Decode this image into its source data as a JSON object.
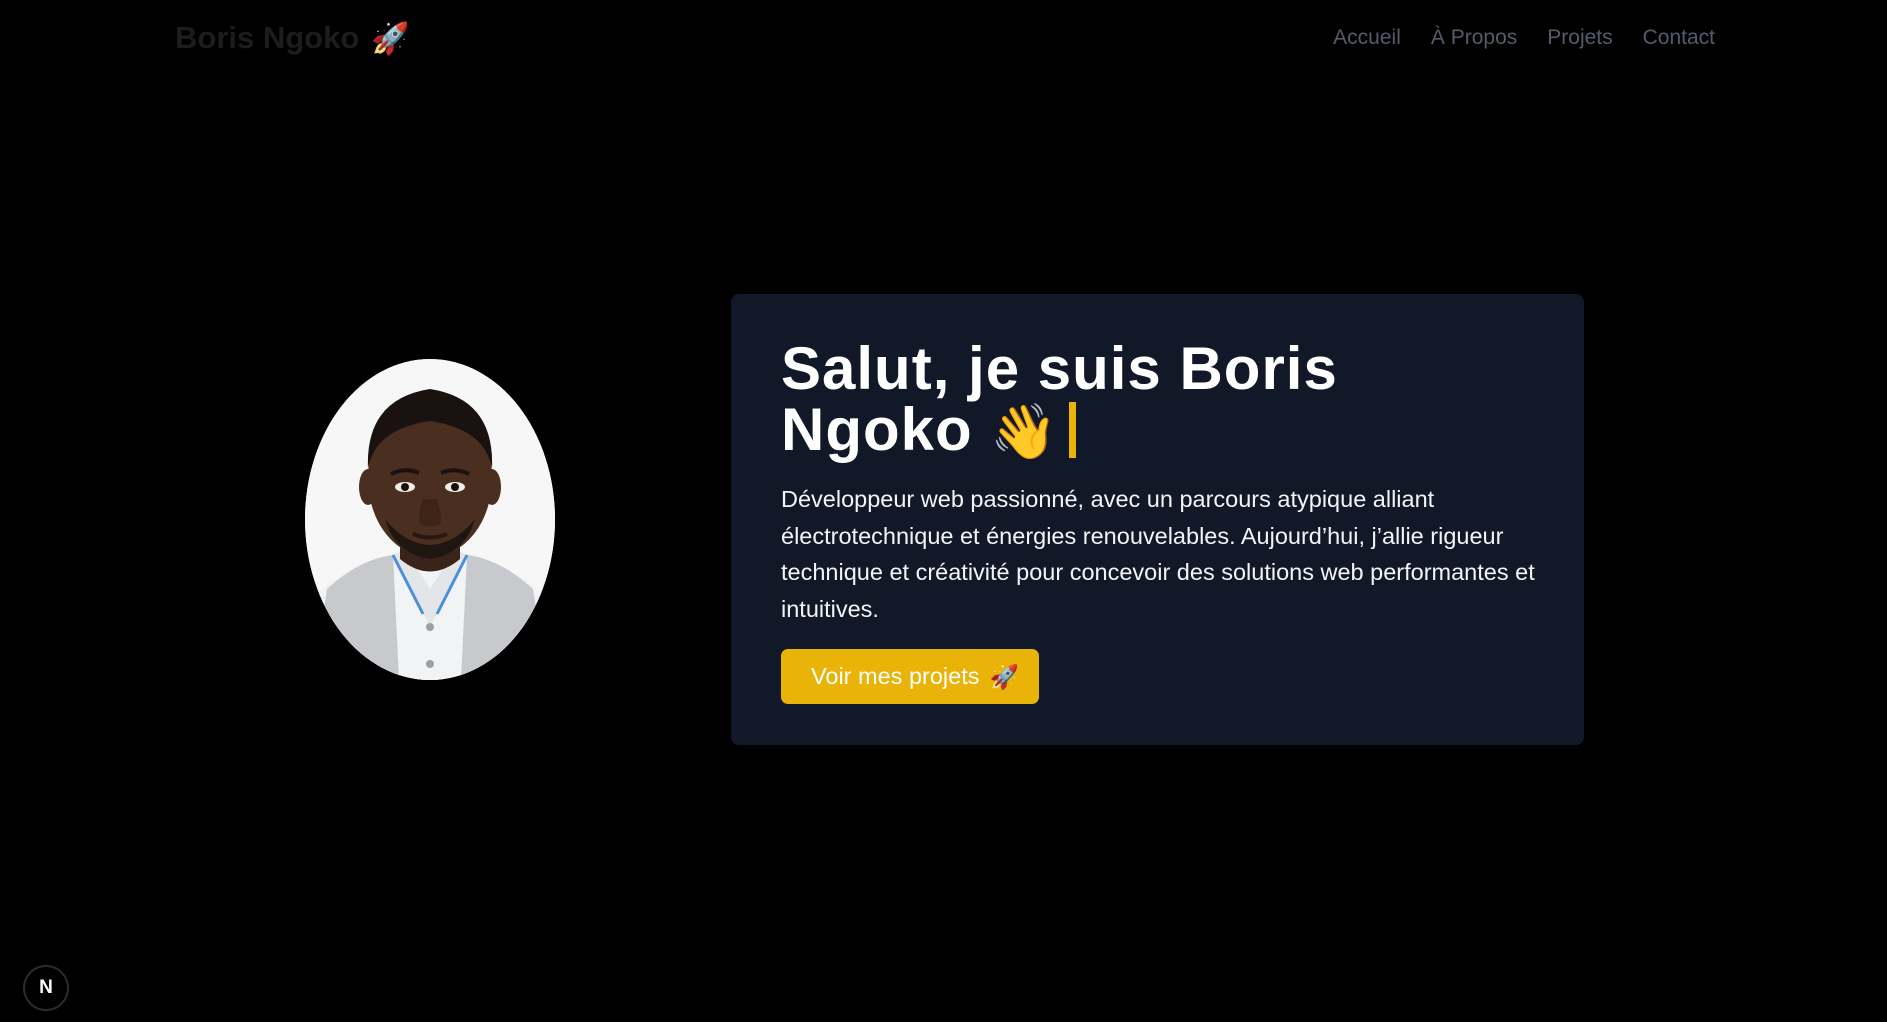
{
  "header": {
    "brand_name": "Boris Ngoko",
    "brand_icon": "🚀",
    "nav": [
      {
        "label": "Accueil"
      },
      {
        "label": "À Propos"
      },
      {
        "label": "Projets"
      },
      {
        "label": "Contact"
      }
    ]
  },
  "hero": {
    "title_line1": "Salut, je suis Boris",
    "title_line2": "Ngoko",
    "wave_icon": "👋",
    "description": "Développeur web passionné, avec un parcours atypique alliant électrotechnique et énergies renouvelables. Aujourd’hui, j’allie rigueur technique et créativité pour concevoir des solutions web performantes et intuitives.",
    "cta_label": "Voir mes projets",
    "cta_icon": "🚀"
  },
  "badge": {
    "letter": "N"
  },
  "colors": {
    "background": "#000000",
    "card": "#111827",
    "accent": "#eab308",
    "nav_text": "#555b6a"
  }
}
